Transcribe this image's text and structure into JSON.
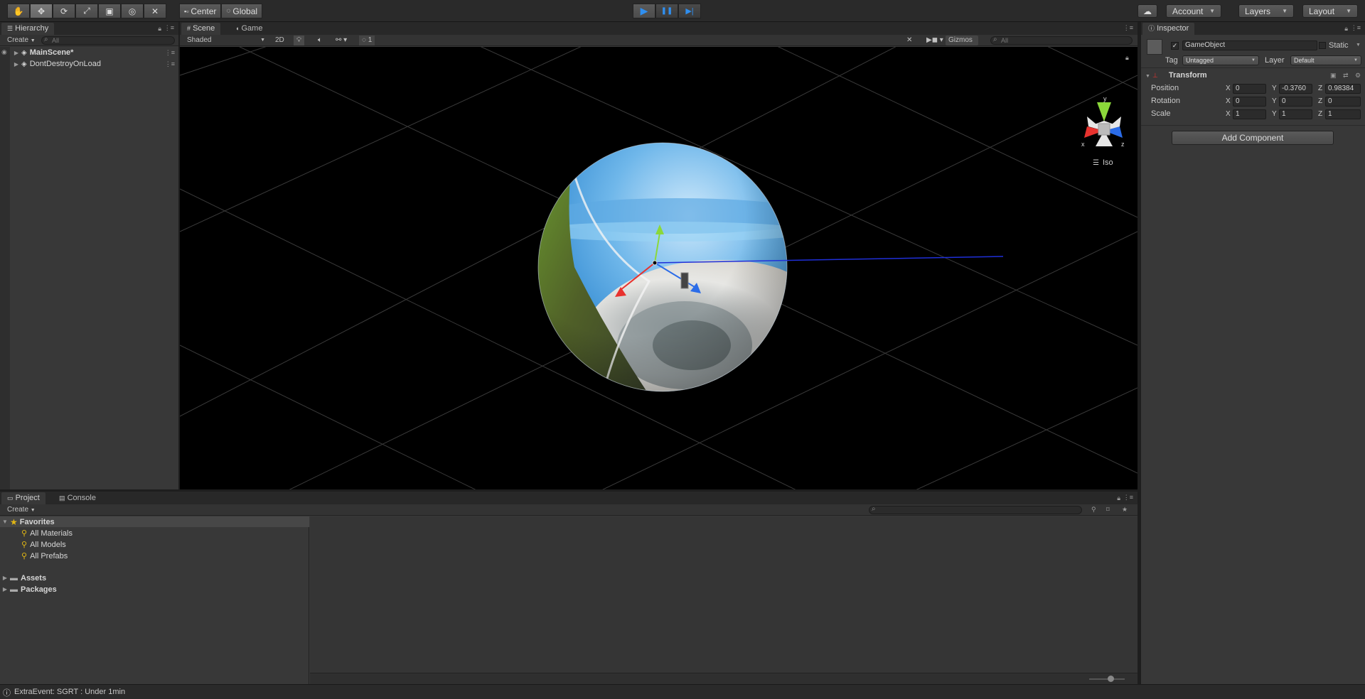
{
  "toolbar": {
    "tools": [
      "hand-tool-icon",
      "move-tool-icon",
      "rotate-tool-icon",
      "scale-tool-icon",
      "rect-tool-icon",
      "transform-tool-icon",
      "custom-tool-icon"
    ],
    "pivot_label": "Center",
    "space_label": "Global",
    "play": [
      "▶",
      "❚❚",
      "▶|"
    ],
    "account_label": "Account",
    "layers_label": "Layers",
    "layout_label": "Layout"
  },
  "hierarchy": {
    "tab_label": "Hierarchy",
    "create_label": "Create",
    "search_placeholder": "All",
    "items": [
      {
        "label": "MainScene*"
      },
      {
        "label": "DontDestroyOnLoad"
      }
    ]
  },
  "scene": {
    "tabs": [
      "Scene",
      "Game"
    ],
    "shading_mode": "Shaded",
    "mode_2d": "2D",
    "hidden_count": "1",
    "gizmos_label": "Gizmos",
    "search_placeholder": "All",
    "projection_label": "Iso",
    "axis_labels": {
      "x": "x",
      "y": "y",
      "z": "z"
    }
  },
  "inspector": {
    "tab_label": "Inspector",
    "object_name": "GameObject",
    "active": true,
    "static_label": "Static",
    "tag_label": "Tag",
    "tag_value": "Untagged",
    "layer_label": "Layer",
    "layer_value": "Default",
    "component_title": "Transform",
    "rows": [
      {
        "label": "Position",
        "x": "0",
        "y": "-0.3760",
        "z": "0.98384"
      },
      {
        "label": "Rotation",
        "x": "0",
        "y": "0",
        "z": "0"
      },
      {
        "label": "Scale",
        "x": "1",
        "y": "1",
        "z": "1"
      }
    ],
    "axis_x": "X",
    "axis_y": "Y",
    "axis_z": "Z",
    "add_component_label": "Add Component"
  },
  "project": {
    "tabs": [
      "Project",
      "Console"
    ],
    "create_label": "Create",
    "favorites_label": "Favorites",
    "favorites": [
      "All Materials",
      "All Models",
      "All Prefabs"
    ],
    "folders": [
      "Assets",
      "Packages"
    ]
  },
  "status": {
    "message": "ExtraEvent: SGRT : Under 1min"
  },
  "colors": {
    "play_blue": "#2f8ff0",
    "axis_x": "#e8322e",
    "axis_y": "#8bd83a",
    "axis_z": "#2b6ce8",
    "favorite_gold": "#e2b714"
  }
}
